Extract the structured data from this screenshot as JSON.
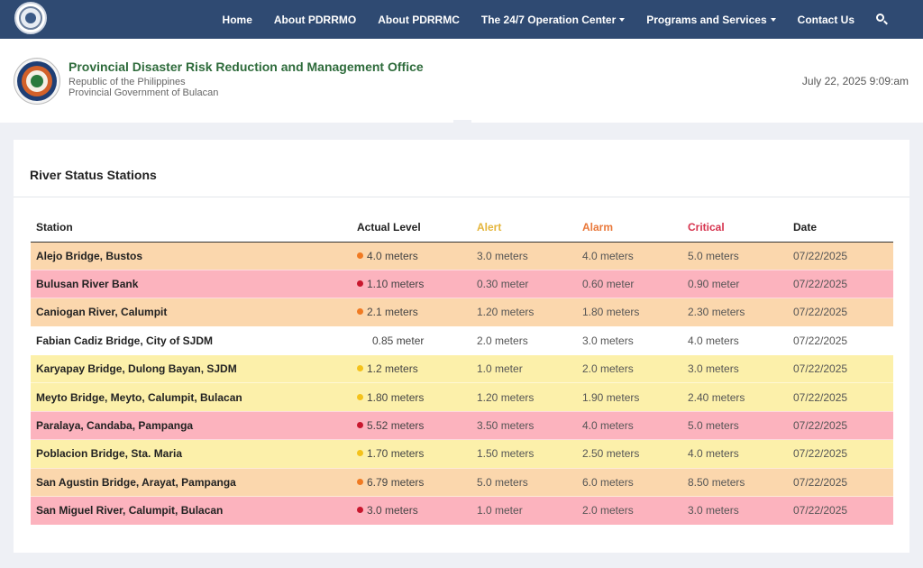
{
  "nav": {
    "links": [
      {
        "label": "Home",
        "dropdown": false
      },
      {
        "label": "About PDRRMO",
        "dropdown": false
      },
      {
        "label": "About PDRRMC",
        "dropdown": false
      },
      {
        "label": "The 24/7 Operation Center",
        "dropdown": true
      },
      {
        "label": "Programs and Services",
        "dropdown": true
      },
      {
        "label": "Contact Us",
        "dropdown": false
      }
    ],
    "search_icon": "search-icon"
  },
  "header": {
    "title": "Provincial Disaster Risk Reduction and Management Office",
    "subtitle1": "Republic of the Philippines",
    "subtitle2": "Provincial Government of Bulacan",
    "datetime": "July 22, 2025 9:09:am"
  },
  "card": {
    "title": "River Status Stations",
    "columns": [
      "Station",
      "Actual Level",
      "Alert",
      "Alarm",
      "Critical",
      "Date"
    ],
    "rows": [
      {
        "station": "Alejo Bridge, Bustos",
        "level": "4.0 meters",
        "alert": "3.0 meters",
        "alarm": "4.0 meters",
        "critical": "5.0 meters",
        "date": "07/22/2025",
        "status": "orange"
      },
      {
        "station": "Bulusan River Bank",
        "level": "1.10 meters",
        "alert": "0.30 meter",
        "alarm": "0.60 meter",
        "critical": "0.90 meter",
        "date": "07/22/2025",
        "status": "red"
      },
      {
        "station": "Caniogan River, Calumpit",
        "level": "2.1 meters",
        "alert": "1.20 meters",
        "alarm": "1.80 meters",
        "critical": "2.30 meters",
        "date": "07/22/2025",
        "status": "orange"
      },
      {
        "station": "Fabian Cadiz Bridge, City of SJDM",
        "level": "0.85 meter",
        "alert": "2.0 meters",
        "alarm": "3.0 meters",
        "critical": "4.0 meters",
        "date": "07/22/2025",
        "status": "white"
      },
      {
        "station": "Karyapay Bridge, Dulong Bayan, SJDM",
        "level": "1.2 meters",
        "alert": "1.0 meter",
        "alarm": "2.0 meters",
        "critical": "3.0 meters",
        "date": "07/22/2025",
        "status": "yellow"
      },
      {
        "station": "Meyto Bridge, Meyto, Calumpit, Bulacan",
        "level": "1.80 meters",
        "alert": "1.20 meters",
        "alarm": "1.90 meters",
        "critical": "2.40 meters",
        "date": "07/22/2025",
        "status": "yellow"
      },
      {
        "station": "Paralaya, Candaba, Pampanga",
        "level": "5.52 meters",
        "alert": "3.50 meters",
        "alarm": "4.0 meters",
        "critical": "5.0 meters",
        "date": "07/22/2025",
        "status": "red"
      },
      {
        "station": "Poblacion Bridge, Sta. Maria",
        "level": "1.70 meters",
        "alert": "1.50 meters",
        "alarm": "2.50 meters",
        "critical": "4.0 meters",
        "date": "07/22/2025",
        "status": "yellow"
      },
      {
        "station": "San Agustin Bridge, Arayat, Pampanga",
        "level": "6.79 meters",
        "alert": "5.0 meters",
        "alarm": "6.0 meters",
        "critical": "8.50 meters",
        "date": "07/22/2025",
        "status": "orange"
      },
      {
        "station": "San Miguel River, Calumpit, Bulacan",
        "level": "3.0 meters",
        "alert": "1.0 meter",
        "alarm": "2.0 meters",
        "critical": "3.0 meters",
        "date": "07/22/2025",
        "status": "red"
      }
    ]
  },
  "colors": {
    "navbar": "#2f4a72",
    "title_green": "#2e6b3b",
    "alert": "#e4b53b",
    "alarm": "#e9783a",
    "critical": "#d6334e",
    "row_orange": "#fbd7ad",
    "row_red": "#fcb3be",
    "row_yellow": "#fcf0aa",
    "dot_orange": "#f07a22",
    "dot_red": "#c8172e",
    "dot_yellow": "#f4c21b"
  }
}
